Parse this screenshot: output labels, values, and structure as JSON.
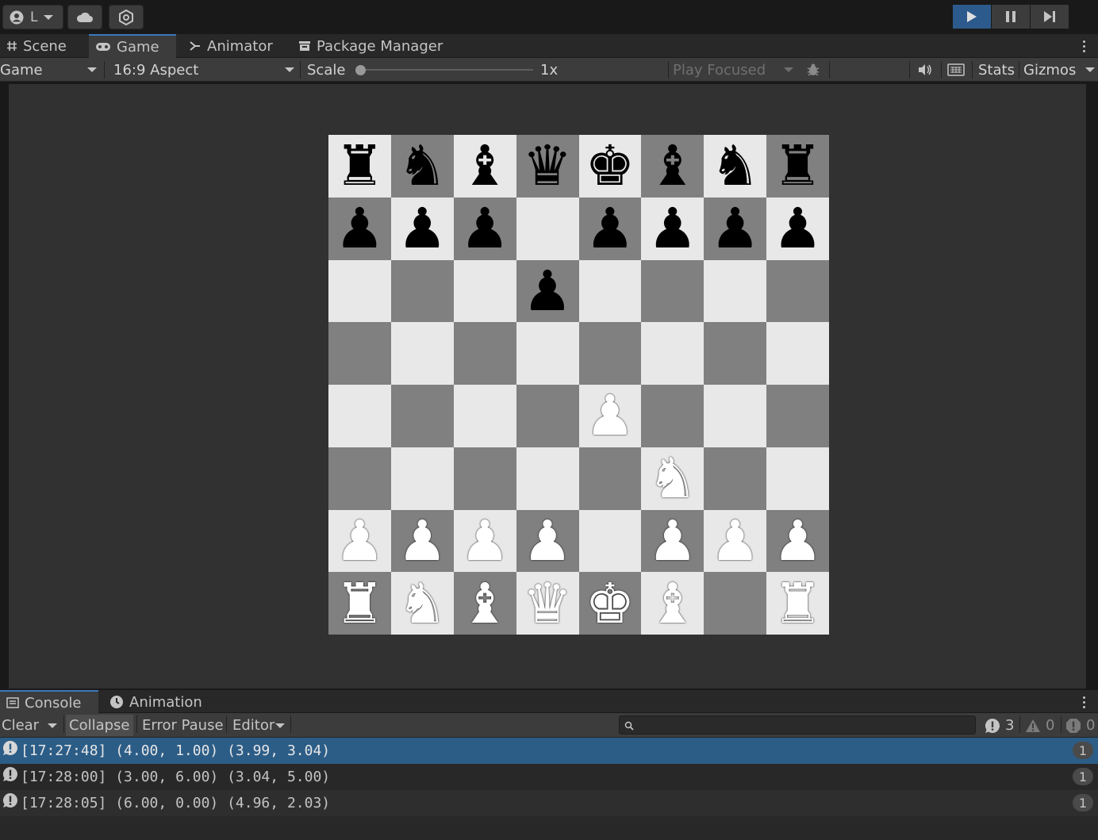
{
  "topbar": {
    "account_label": "L"
  },
  "scene_tabs": {
    "scene": "Scene",
    "game": "Game",
    "animator": "Animator",
    "package_manager": "Package Manager"
  },
  "game_toolbar": {
    "display": "Game",
    "aspect": "16:9 Aspect",
    "scale_label": "Scale",
    "scale_value": "1x",
    "scale_fraction": 0.0,
    "play_mode": "Play Focused",
    "stats": "Stats",
    "gizmos": "Gizmos"
  },
  "board": {
    "light_color": "#e8e8e8",
    "dark_color": "#808080",
    "rows": [
      [
        "br",
        "bn",
        "bb",
        "bq",
        "bk",
        "bb",
        "bn",
        "br"
      ],
      [
        "bp",
        "bp",
        "bp",
        "",
        "bp",
        "bp",
        "bp",
        "bp"
      ],
      [
        "",
        "",
        "",
        "bp",
        "",
        "",
        "",
        ""
      ],
      [
        "",
        "",
        "",
        "",
        "",
        "",
        "",
        ""
      ],
      [
        "",
        "",
        "",
        "",
        "wp",
        "",
        "",
        ""
      ],
      [
        "",
        "",
        "",
        "",
        "",
        "wn",
        "",
        ""
      ],
      [
        "wp",
        "wp",
        "wp",
        "wp",
        "",
        "wp",
        "wp",
        "wp"
      ],
      [
        "wr",
        "wn",
        "wb",
        "wq",
        "wk",
        "wb",
        "",
        "wr"
      ]
    ]
  },
  "console_tabs": {
    "console": "Console",
    "animation": "Animation"
  },
  "console_toolbar": {
    "clear": "Clear",
    "collapse": "Collapse",
    "error_pause": "Error Pause",
    "editor": "Editor",
    "search_placeholder": "",
    "count_log": "3",
    "count_warn": "0",
    "count_error": "0"
  },
  "log": [
    {
      "text": "[17:27:48] (4.00, 1.00) (3.99, 3.04)",
      "count": "1"
    },
    {
      "text": "[17:28:00] (3.00, 6.00) (3.04, 5.00)",
      "count": "1"
    },
    {
      "text": "[17:28:05] (6.00, 0.00) (4.96, 2.03)",
      "count": "1"
    }
  ]
}
